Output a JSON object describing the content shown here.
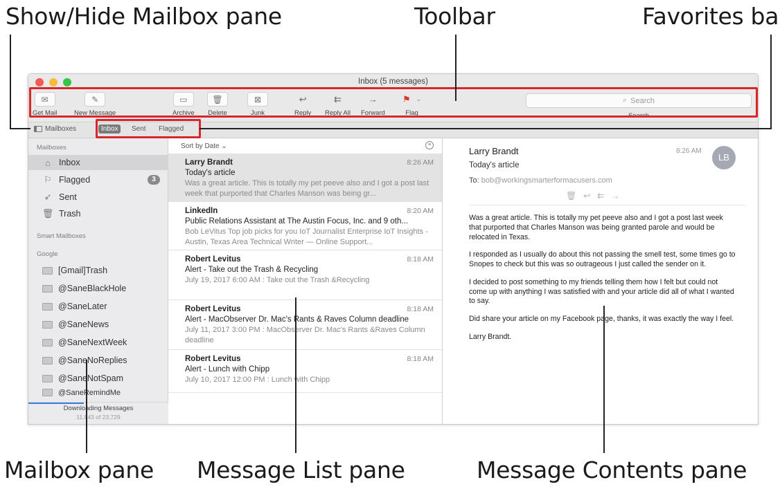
{
  "callouts": {
    "show_hide": "Show/Hide Mailbox pane",
    "toolbar": "Toolbar",
    "favorites_bar": "Favorites bar",
    "mailbox_pane": "Mailbox pane",
    "message_list_pane": "Message List pane",
    "message_contents_pane": "Message Contents pane"
  },
  "window": {
    "title": "Inbox (5 messages)"
  },
  "toolbar": {
    "get_mail": {
      "label": "Get Mail",
      "icon": "envelope-icon"
    },
    "new_message": {
      "label": "New Message",
      "icon": "compose-icon"
    },
    "archive": {
      "label": "Archive",
      "icon": "archive-icon"
    },
    "delete": {
      "label": "Delete",
      "icon": "trash-icon"
    },
    "junk": {
      "label": "Junk",
      "icon": "junk-icon"
    },
    "reply": {
      "label": "Reply",
      "icon": "reply-icon"
    },
    "reply_all": {
      "label": "Reply All",
      "icon": "reply-all-icon"
    },
    "forward": {
      "label": "Forward",
      "icon": "forward-icon"
    },
    "flag": {
      "label": "Flag",
      "icon": "flag-icon",
      "color": "#e0302c"
    },
    "search": {
      "placeholder": "Search",
      "label": "Search"
    }
  },
  "favorites": {
    "mailboxes": "Mailboxes",
    "items": [
      "Inbox",
      "Sent",
      "Flagged"
    ],
    "active": "Inbox"
  },
  "sidebar": {
    "mailboxes_header": "Mailboxes",
    "items": [
      {
        "label": "Inbox",
        "icon": "inbox-icon",
        "selected": true
      },
      {
        "label": "Flagged",
        "icon": "flag-icon",
        "badge": "3"
      },
      {
        "label": "Sent",
        "icon": "sent-icon"
      },
      {
        "label": "Trash",
        "icon": "trash-icon"
      }
    ],
    "smart_header": "Smart Mailboxes",
    "google_header": "Google",
    "google_items": [
      "[Gmail]Trash",
      "@SaneBlackHole",
      "@SaneLater",
      "@SaneNews",
      "@SaneNextWeek",
      "@SaneNoReplies",
      "@SaneNotSpam",
      "@SaneRemindMe"
    ],
    "footer": {
      "status": "Downloading Messages",
      "progress": "11,843 of 23,729"
    }
  },
  "message_list": {
    "sort_label": "Sort by Date ⌄",
    "messages": [
      {
        "from": "Larry Brandt",
        "time": "8:26 AM",
        "subject": "Today's article",
        "preview": "Was a great article. This is totally my pet peeve also and I got a post last week that purported that Charles Manson was being gr...",
        "selected": true
      },
      {
        "from": "LinkedIn",
        "time": "8:20 AM",
        "subject": "Public Relations Assistant at The Austin Focus, Inc. and 9 oth...",
        "preview": "Bob LeVitus Top job picks for you IoT Journalist Enterprise IoT Insights - Austin, Texas Area Technical Writer — Online Support..."
      },
      {
        "from": "Robert Levitus",
        "time": "8:18 AM",
        "subject": "Alert - Take out the Trash & Recycling",
        "preview": "July 19, 2017 6:00 AM : Take out the Trash &Recycling"
      },
      {
        "from": "Robert Levitus",
        "time": "8:18 AM",
        "subject": "Alert - MacObserver Dr. Mac's Rants & Raves Column deadline",
        "preview": "July 11, 2017 3:00 PM : MacObserver Dr. Mac's Rants &Raves Column deadline"
      },
      {
        "from": "Robert Levitus",
        "time": "8:18 AM",
        "subject": "Alert - Lunch with Chipp",
        "preview": "July 10, 2017 12:00 PM : Lunch with Chipp"
      }
    ]
  },
  "content": {
    "from": "Larry Brandt",
    "time": "8:26 AM",
    "subject": "Today's article",
    "to_label": "To:",
    "to": "bob@workingsmarterformacusers.com",
    "avatar": "LB",
    "body": [
      "Was a great article.  This is totally my pet peeve also and I got a post last week that purported that Charles Manson was being granted parole and would be relocated in Texas.",
      "I responded as I usually do about this not passing the smell test, some times go to Snopes to check but this was so outrageous I just called the sender on it.",
      "I decided to post something to my friends telling them how I felt but could not come up with anything I was satisfied with and your article did all of what I wanted to say.",
      "Did share your article on my Facebook page, thanks, it was exactly the way I feel.",
      "Larry Brandt."
    ]
  },
  "colors": {
    "highlight_box": "#d9262b",
    "flag": "#e0302c"
  }
}
